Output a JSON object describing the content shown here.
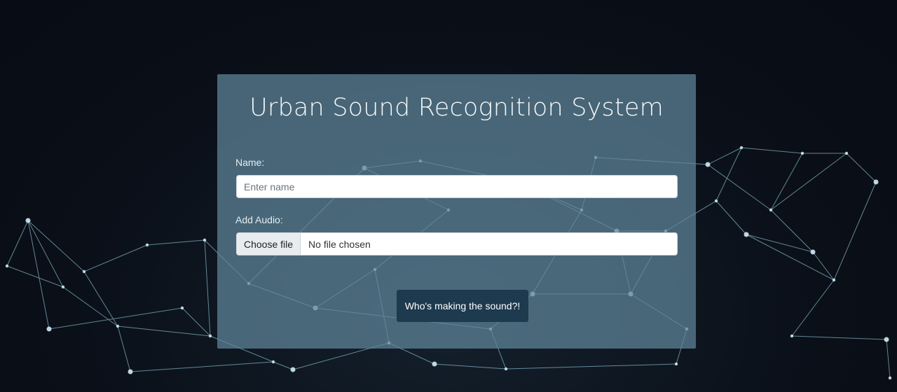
{
  "page": {
    "title": "Urban Sound Recognition System"
  },
  "form": {
    "name_label": "Name:",
    "name_placeholder": "Enter name",
    "name_value": "",
    "audio_label": "Add Audio:",
    "file_button_label": "Choose file",
    "file_status": "No file chosen",
    "submit_label": "Who's making the sound?!"
  },
  "colors": {
    "background": "#0a0f18",
    "card": "#5f879b",
    "button": "#1d3a4f",
    "network": "#8fc7d8"
  }
}
